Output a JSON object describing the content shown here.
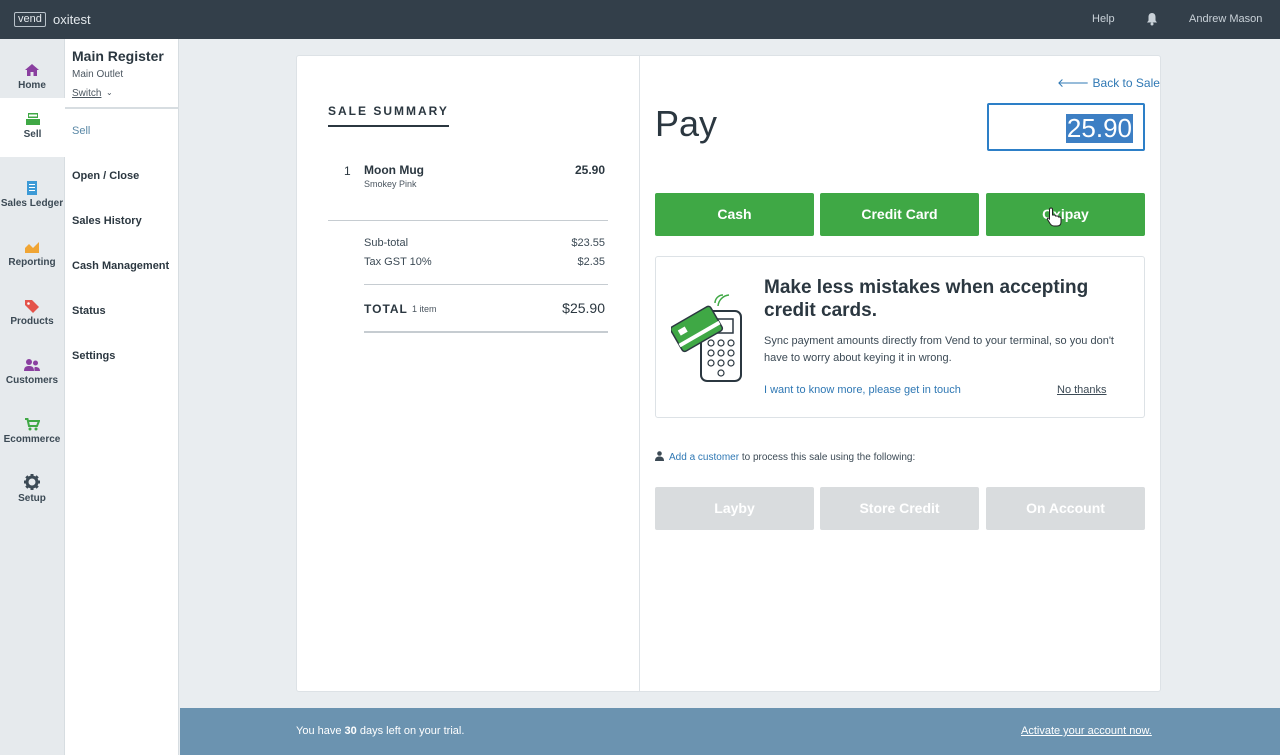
{
  "topbar": {
    "logo_text": "vend",
    "store_name": "oxitest",
    "help_label": "Help",
    "user_name": "Andrew Mason"
  },
  "leftnav": {
    "items": [
      {
        "label": "Home",
        "icon": "home-icon",
        "color": "#8a3fa0"
      },
      {
        "label": "Sell",
        "icon": "register-icon",
        "color": "#3fa845",
        "active": true
      },
      {
        "label": "Sales Ledger",
        "icon": "ledger-icon",
        "color": "#3c9ad6"
      },
      {
        "label": "Reporting",
        "icon": "chart-icon",
        "color": "#f0a534"
      },
      {
        "label": "Products",
        "icon": "tag-icon",
        "color": "#e4534a"
      },
      {
        "label": "Customers",
        "icon": "people-icon",
        "color": "#8a3fa0"
      },
      {
        "label": "Ecommerce",
        "icon": "cart-icon",
        "color": "#3fa845"
      },
      {
        "label": "Setup",
        "icon": "gear-icon",
        "color": "#3c4a55"
      }
    ]
  },
  "subnav": {
    "register_title": "Main Register",
    "outlet": "Main Outlet",
    "switch_label": "Switch",
    "items": [
      {
        "label": "Sell",
        "active": true
      },
      {
        "label": "Open / Close"
      },
      {
        "label": "Sales History"
      },
      {
        "label": "Cash Management"
      },
      {
        "label": "Status"
      },
      {
        "label": "Settings"
      }
    ]
  },
  "summary": {
    "title": "SALE SUMMARY",
    "line_items": [
      {
        "qty": "1",
        "name": "Moon Mug",
        "variant": "Smokey Pink",
        "price": "25.90"
      }
    ],
    "subtotal_label": "Sub-total",
    "subtotal_value": "$23.55",
    "tax_label": "Tax GST 10%",
    "tax_value": "$2.35",
    "total_label": "TOTAL",
    "total_count": "1 item",
    "total_value": "$25.90"
  },
  "payment": {
    "back_label": "Back to Sale",
    "title": "Pay",
    "amount": "25.90",
    "methods": [
      "Cash",
      "Credit Card",
      "Oxipay"
    ],
    "accent_color": "#3fa845"
  },
  "promo": {
    "title": "Make less mistakes when accepting credit cards.",
    "body": "Sync payment amounts directly from Vend to your terminal, so you don't have to worry about keying it in wrong.",
    "cta": "I want to know more, please get in touch",
    "dismiss": "No thanks"
  },
  "customer": {
    "link_label": "Add a customer",
    "suffix": " to process this sale using the following:",
    "methods": [
      "Layby",
      "Store Credit",
      "On Account"
    ]
  },
  "footer": {
    "text_before": "You have ",
    "days": "30",
    "text_after": " days left on your trial.",
    "activate_label": "Activate your account now."
  }
}
